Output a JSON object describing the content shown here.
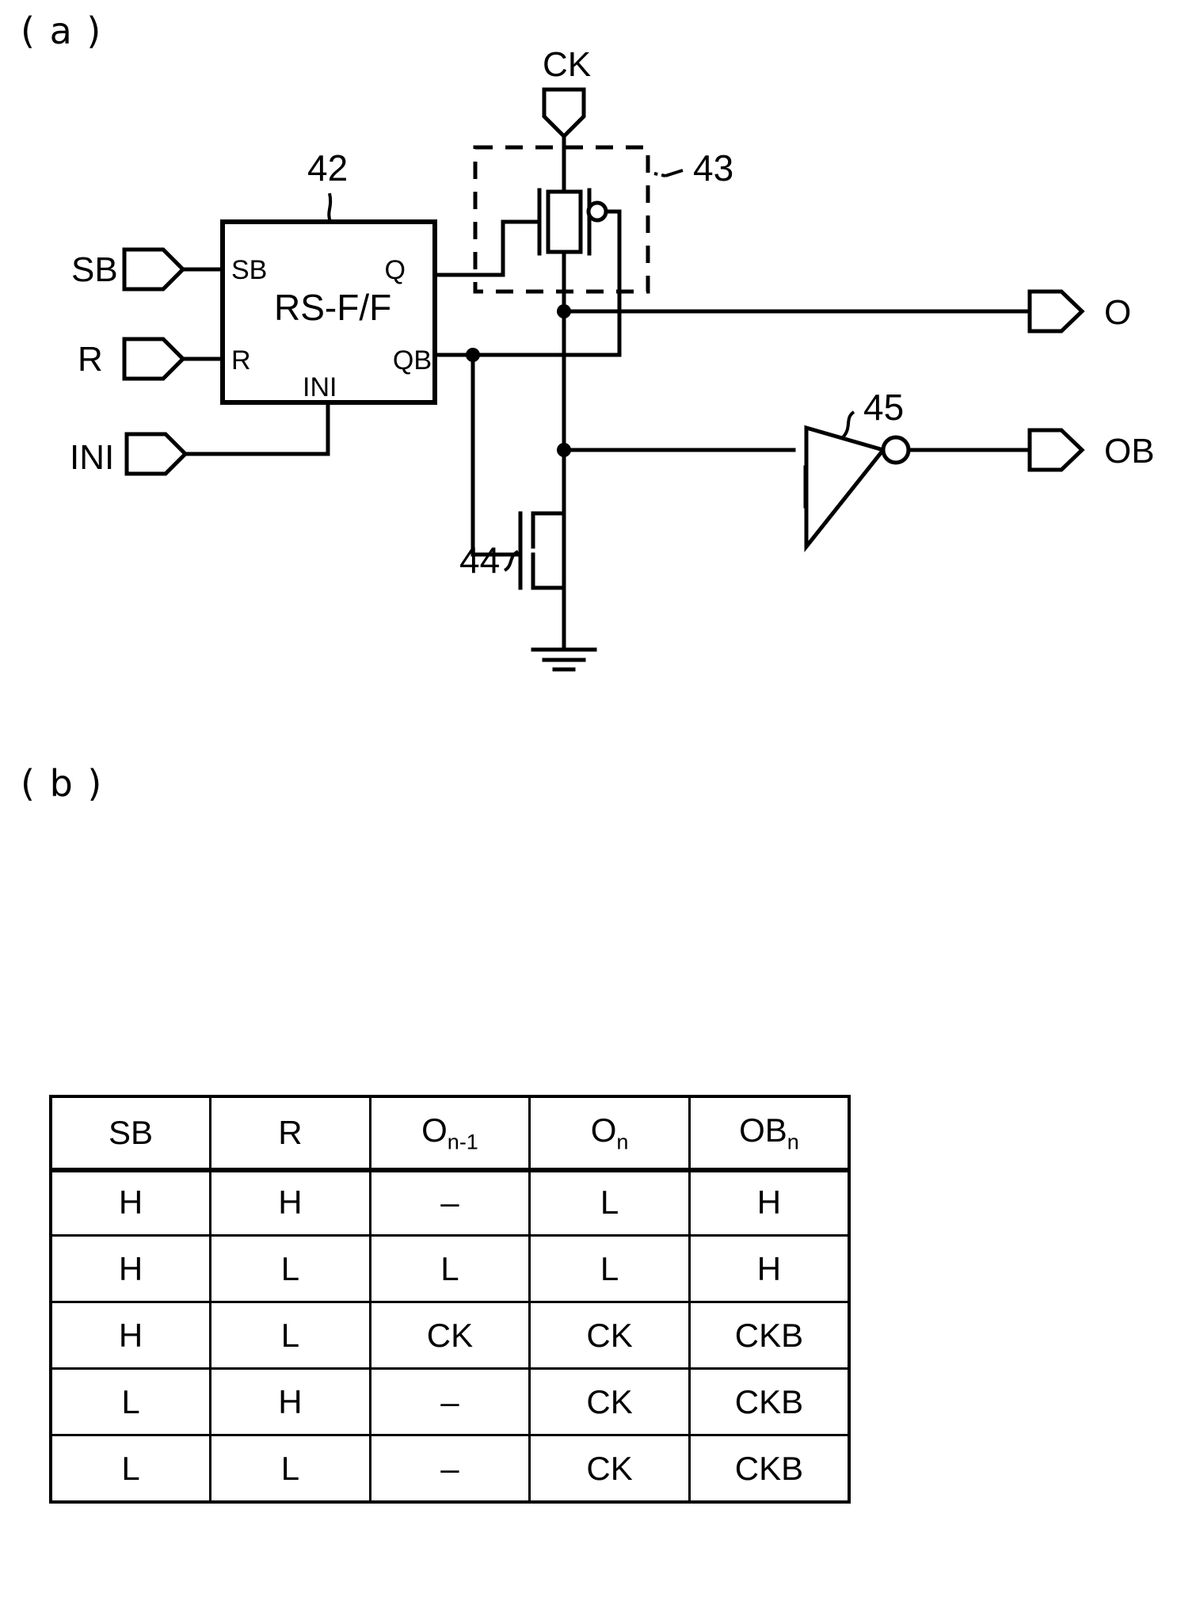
{
  "figure": {
    "panel_a_label": "( a )",
    "panel_b_label": "( b )"
  },
  "circuit": {
    "block": {
      "ref": "42",
      "title": "RS-F/F",
      "pin_sb": "SB",
      "pin_r": "R",
      "pin_ini": "INI",
      "pin_q": "Q",
      "pin_qb": "QB"
    },
    "transmission_gate": {
      "ref": "43"
    },
    "nmos": {
      "ref": "44"
    },
    "inverter": {
      "ref": "45"
    },
    "ports": {
      "in_sb": "SB",
      "in_r": "R",
      "in_ini": "INI",
      "in_ck": "CK",
      "out_o": "O",
      "out_ob": "OB"
    }
  },
  "chart_data": {
    "type": "table",
    "title": "",
    "columns": [
      "SB",
      "R",
      "O",
      "O",
      "OB"
    ],
    "column_labels": [
      {
        "base": "SB",
        "sub": ""
      },
      {
        "base": "R",
        "sub": ""
      },
      {
        "base": "O",
        "sub": "n-1"
      },
      {
        "base": "O",
        "sub": "n"
      },
      {
        "base": "OB",
        "sub": "n"
      }
    ],
    "rows": [
      [
        "H",
        "H",
        "–",
        "L",
        "H"
      ],
      [
        "H",
        "L",
        "L",
        "L",
        "H"
      ],
      [
        "H",
        "L",
        "CK",
        "CK",
        "CKB"
      ],
      [
        "L",
        "H",
        "–",
        "CK",
        "CKB"
      ],
      [
        "L",
        "L",
        "–",
        "CK",
        "CKB"
      ]
    ]
  }
}
